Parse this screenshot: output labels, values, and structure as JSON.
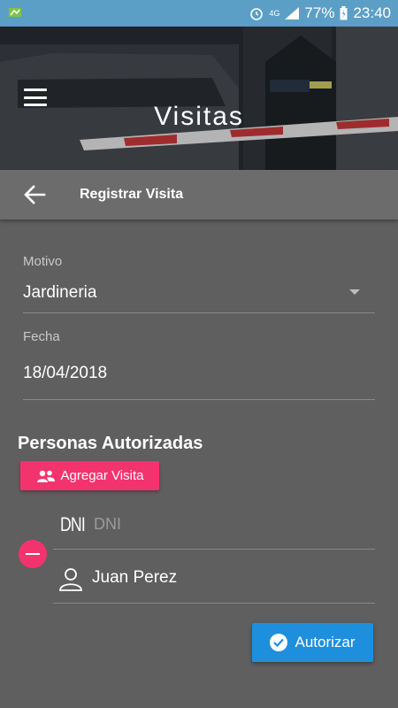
{
  "status_bar": {
    "network": "4G",
    "battery": "77%",
    "time": "23:40",
    "icons": [
      "notification-icon",
      "alarm-icon",
      "signal-icon",
      "battery-icon"
    ]
  },
  "header": {
    "title": "Visitas",
    "menu_icon": "hamburger-menu-icon"
  },
  "toolbar": {
    "back_icon": "arrow-left-icon",
    "title": "Registrar Visita"
  },
  "form": {
    "motivo": {
      "label": "Motivo",
      "value": "Jardineria"
    },
    "fecha": {
      "label": "Fecha",
      "value": "18/04/2018"
    }
  },
  "personas": {
    "title": "Personas Autorizadas",
    "add_button_label": "Agregar Visita",
    "dni_icon_text": "DNI",
    "dni_placeholder": "DNI",
    "person_name": "Juan Perez"
  },
  "actions": {
    "authorize_label": "Autorizar"
  },
  "colors": {
    "accent_pink": "#f3336e",
    "primary_blue": "#1e8fdc",
    "statusbar": "#5b9fc6"
  }
}
